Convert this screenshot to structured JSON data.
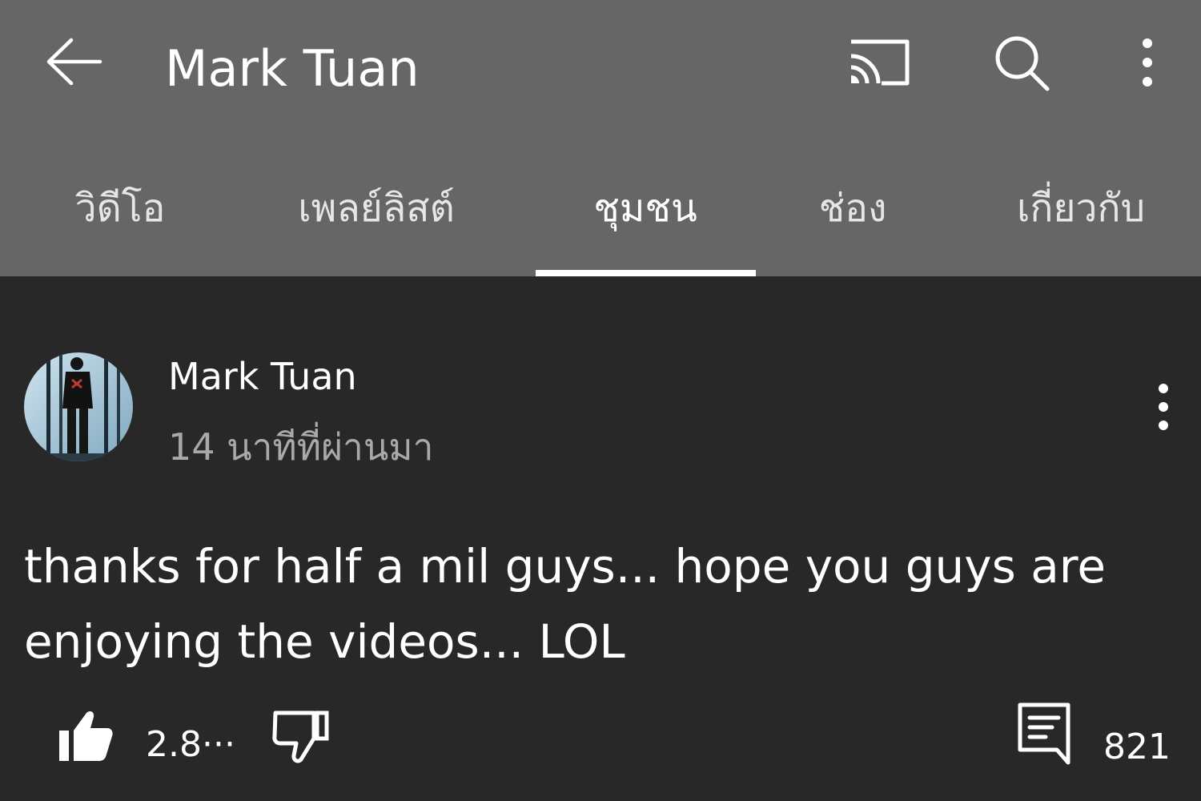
{
  "appbar": {
    "title": "Mark Tuan",
    "back_icon": "arrow-left-icon",
    "cast_icon": "cast-icon",
    "search_icon": "search-icon",
    "more_icon": "more-vertical-icon",
    "background_color": "#666666"
  },
  "tabs": [
    {
      "label": "วิดีโอ",
      "active": false
    },
    {
      "label": "เพลย์ลิสต์",
      "active": false
    },
    {
      "label": "ชุมชน",
      "active": true
    },
    {
      "label": "ช่อง",
      "active": false
    },
    {
      "label": "เกี่ยวกับ",
      "active": false
    }
  ],
  "post": {
    "author": "Mark Tuan",
    "timestamp": "14 นาทีที่ผ่านมา",
    "text": "thanks for half a mil guys... hope you guys are enjoying the videos... LOL",
    "like_count": "2.8···",
    "comment_count": "821",
    "like_icon": "thumbs-up-filled-icon",
    "dislike_icon": "thumbs-down-outline-icon",
    "comment_icon": "comment-icon",
    "menu_icon": "more-vertical-icon"
  },
  "colors": {
    "page_background": "#282828",
    "text_primary": "#ffffff",
    "text_secondary": "#a9a9a9"
  }
}
